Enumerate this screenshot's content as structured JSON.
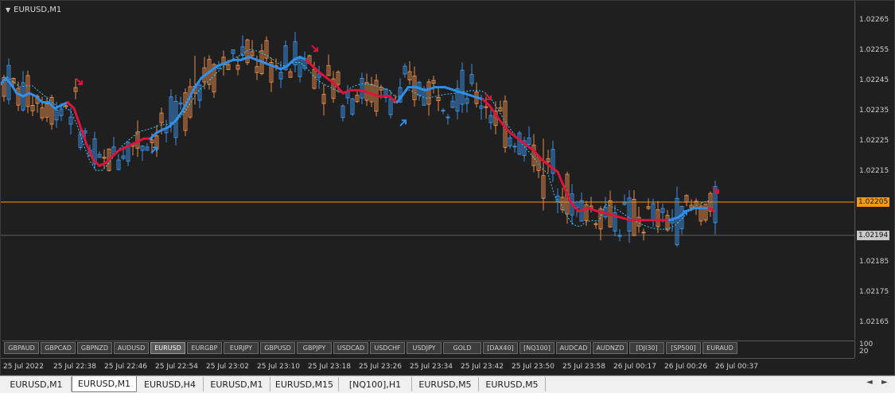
{
  "window": {
    "title": "EURUSD,M1"
  },
  "chart_data": {
    "type": "candlestick",
    "symbol": "EURUSD",
    "timeframe": "M1",
    "ylim": [
      1.0216,
      1.0227
    ],
    "price_ticks": [
      "1.02265",
      "1.02255",
      "1.02245",
      "1.02235",
      "1.02225",
      "1.02215",
      "1.02205",
      "1.02195",
      "1.02185",
      "1.02175",
      "1.02165"
    ],
    "bid_price": "1.02205",
    "ask_price": "1.02194",
    "indicator_ticks": [
      "100",
      "20"
    ],
    "time_ticks": [
      "25 Jul 2022",
      "25 Jul 22:38",
      "25 Jul 22:46",
      "25 Jul 22:54",
      "25 Jul 23:02",
      "25 Jul 23:10",
      "25 Jul 23:18",
      "25 Jul 23:26",
      "25 Jul 23:34",
      "25 Jul 23:42",
      "25 Jul 23:50",
      "25 Jul 23:58",
      "26 Jul 00:17",
      "26 Jul 00:26",
      "26 Jul 00:37"
    ],
    "ma_trend": [
      {
        "x": 0,
        "y": 1.02244,
        "c": "blue"
      },
      {
        "x": 6,
        "y": 1.02246,
        "c": "blue"
      },
      {
        "x": 13,
        "y": 1.02244,
        "c": "blue"
      },
      {
        "x": 20,
        "y": 1.02241,
        "c": "blue"
      },
      {
        "x": 28,
        "y": 1.0224,
        "c": "blue"
      },
      {
        "x": 36,
        "y": 1.02241,
        "c": "blue"
      },
      {
        "x": 44,
        "y": 1.0224,
        "c": "blue"
      },
      {
        "x": 52,
        "y": 1.02238,
        "c": "blue"
      },
      {
        "x": 60,
        "y": 1.02238,
        "c": "blue"
      },
      {
        "x": 68,
        "y": 1.02236,
        "c": "blue"
      },
      {
        "x": 76,
        "y": 1.02237,
        "c": "blue"
      },
      {
        "x": 84,
        "y": 1.02238,
        "c": "blue"
      },
      {
        "x": 92,
        "y": 1.02236,
        "c": "red"
      },
      {
        "x": 100,
        "y": 1.0223,
        "c": "red"
      },
      {
        "x": 108,
        "y": 1.02224,
        "c": "red"
      },
      {
        "x": 116,
        "y": 1.02219,
        "c": "red"
      },
      {
        "x": 124,
        "y": 1.02217,
        "c": "red"
      },
      {
        "x": 132,
        "y": 1.02218,
        "c": "red"
      },
      {
        "x": 140,
        "y": 1.0222,
        "c": "red"
      },
      {
        "x": 148,
        "y": 1.02222,
        "c": "red"
      },
      {
        "x": 156,
        "y": 1.02223,
        "c": "red"
      },
      {
        "x": 164,
        "y": 1.02224,
        "c": "red"
      },
      {
        "x": 172,
        "y": 1.02225,
        "c": "red"
      },
      {
        "x": 180,
        "y": 1.02226,
        "c": "red"
      },
      {
        "x": 188,
        "y": 1.02226,
        "c": "red"
      },
      {
        "x": 196,
        "y": 1.02228,
        "c": "blue"
      },
      {
        "x": 204,
        "y": 1.02229,
        "c": "blue"
      },
      {
        "x": 212,
        "y": 1.0223,
        "c": "blue"
      },
      {
        "x": 220,
        "y": 1.02232,
        "c": "blue"
      },
      {
        "x": 228,
        "y": 1.02235,
        "c": "blue"
      },
      {
        "x": 236,
        "y": 1.02239,
        "c": "blue"
      },
      {
        "x": 244,
        "y": 1.02243,
        "c": "blue"
      },
      {
        "x": 252,
        "y": 1.02246,
        "c": "blue"
      },
      {
        "x": 262,
        "y": 1.02248,
        "c": "blue"
      },
      {
        "x": 272,
        "y": 1.0225,
        "c": "blue"
      },
      {
        "x": 282,
        "y": 1.02251,
        "c": "blue"
      },
      {
        "x": 292,
        "y": 1.02252,
        "c": "blue"
      },
      {
        "x": 302,
        "y": 1.02252,
        "c": "blue"
      },
      {
        "x": 312,
        "y": 1.02253,
        "c": "blue"
      },
      {
        "x": 322,
        "y": 1.02252,
        "c": "blue"
      },
      {
        "x": 332,
        "y": 1.02251,
        "c": "blue"
      },
      {
        "x": 342,
        "y": 1.0225,
        "c": "blue"
      },
      {
        "x": 352,
        "y": 1.02249,
        "c": "blue"
      },
      {
        "x": 360,
        "y": 1.0225,
        "c": "blue"
      },
      {
        "x": 368,
        "y": 1.02252,
        "c": "blue"
      },
      {
        "x": 376,
        "y": 1.02253,
        "c": "blue"
      },
      {
        "x": 384,
        "y": 1.02252,
        "c": "blue"
      },
      {
        "x": 392,
        "y": 1.0225,
        "c": "red"
      },
      {
        "x": 400,
        "y": 1.02248,
        "c": "red"
      },
      {
        "x": 410,
        "y": 1.02246,
        "c": "red"
      },
      {
        "x": 420,
        "y": 1.02244,
        "c": "red"
      },
      {
        "x": 430,
        "y": 1.02241,
        "c": "red"
      },
      {
        "x": 440,
        "y": 1.02242,
        "c": "red"
      },
      {
        "x": 452,
        "y": 1.02242,
        "c": "red"
      },
      {
        "x": 464,
        "y": 1.02241,
        "c": "red"
      },
      {
        "x": 476,
        "y": 1.0224,
        "c": "red"
      },
      {
        "x": 488,
        "y": 1.0224,
        "c": "red"
      },
      {
        "x": 498,
        "y": 1.02238,
        "c": "red"
      },
      {
        "x": 504,
        "y": 1.0224,
        "c": "blue"
      },
      {
        "x": 512,
        "y": 1.02243,
        "c": "blue"
      },
      {
        "x": 522,
        "y": 1.02243,
        "c": "blue"
      },
      {
        "x": 534,
        "y": 1.02242,
        "c": "blue"
      },
      {
        "x": 546,
        "y": 1.02243,
        "c": "blue"
      },
      {
        "x": 558,
        "y": 1.02243,
        "c": "blue"
      },
      {
        "x": 570,
        "y": 1.02242,
        "c": "blue"
      },
      {
        "x": 582,
        "y": 1.02241,
        "c": "blue"
      },
      {
        "x": 594,
        "y": 1.0224,
        "c": "blue"
      },
      {
        "x": 606,
        "y": 1.02239,
        "c": "blue"
      },
      {
        "x": 614,
        "y": 1.02237,
        "c": "red"
      },
      {
        "x": 622,
        "y": 1.02234,
        "c": "red"
      },
      {
        "x": 630,
        "y": 1.02231,
        "c": "red"
      },
      {
        "x": 640,
        "y": 1.02228,
        "c": "red"
      },
      {
        "x": 650,
        "y": 1.02226,
        "c": "red"
      },
      {
        "x": 660,
        "y": 1.02224,
        "c": "red"
      },
      {
        "x": 670,
        "y": 1.02222,
        "c": "red"
      },
      {
        "x": 680,
        "y": 1.02219,
        "c": "red"
      },
      {
        "x": 690,
        "y": 1.02217,
        "c": "red"
      },
      {
        "x": 700,
        "y": 1.02215,
        "c": "red"
      },
      {
        "x": 708,
        "y": 1.0221,
        "c": "red"
      },
      {
        "x": 716,
        "y": 1.02205,
        "c": "red"
      },
      {
        "x": 726,
        "y": 1.02202,
        "c": "red"
      },
      {
        "x": 738,
        "y": 1.02203,
        "c": "red"
      },
      {
        "x": 750,
        "y": 1.02202,
        "c": "red"
      },
      {
        "x": 764,
        "y": 1.02201,
        "c": "red"
      },
      {
        "x": 778,
        "y": 1.022,
        "c": "red"
      },
      {
        "x": 792,
        "y": 1.02199,
        "c": "red"
      },
      {
        "x": 808,
        "y": 1.02199,
        "c": "red"
      },
      {
        "x": 824,
        "y": 1.02199,
        "c": "red"
      },
      {
        "x": 840,
        "y": 1.02199,
        "c": "red"
      },
      {
        "x": 852,
        "y": 1.022,
        "c": "blue"
      },
      {
        "x": 862,
        "y": 1.02202,
        "c": "blue"
      },
      {
        "x": 872,
        "y": 1.02203,
        "c": "blue"
      },
      {
        "x": 882,
        "y": 1.02203,
        "c": "blue"
      },
      {
        "x": 890,
        "y": 1.02203,
        "c": "blue"
      },
      {
        "x": 896,
        "y": 1.02202,
        "c": "red"
      }
    ],
    "candles_note": "candle series drawn procedurally from ma_trend with deviations",
    "signal_arrows": [
      {
        "x": 98,
        "y": 1.02245,
        "dir": "down",
        "c": "red"
      },
      {
        "x": 192,
        "y": 1.02222,
        "dir": "up",
        "c": "blue"
      },
      {
        "x": 394,
        "y": 1.02256,
        "dir": "down",
        "c": "red"
      },
      {
        "x": 505,
        "y": 1.02231,
        "dir": "up",
        "c": "blue"
      },
      {
        "x": 612,
        "y": 1.0224,
        "dir": "down",
        "c": "red"
      },
      {
        "x": 858,
        "y": 1.02201,
        "dir": "up",
        "c": "blue"
      },
      {
        "x": 898,
        "y": 1.02209,
        "dir": "down",
        "c": "red"
      }
    ],
    "colors": {
      "up": "#3b8fe0",
      "down": "#e0894a",
      "ma_up": "#2f8fea",
      "ma_down": "#dc143c",
      "bid": "#f09a18",
      "ask": "#5e5e5e",
      "dashed": "#40c8e8"
    }
  },
  "symbol_buttons": [
    "GBPAUD",
    "GBPCAD",
    "GBPNZD",
    "AUDUSD",
    "EURUSD",
    "EURGBP",
    "EURJPY",
    "GBPUSD",
    "GBPJPY",
    "USDCAD",
    "USDCHF",
    "USDJPY",
    "GOLD",
    "[DAX40]",
    "[NQ100]",
    "AUDCAD",
    "AUDNZD",
    "[DJI30]",
    "[SP500]",
    "EURAUD"
  ],
  "active_symbol": "EURUSD",
  "tabs": [
    "EURUSD,M1",
    "EURUSD,M1",
    "EURUSD,H4",
    "EURUSD,M1",
    "EURUSD,M15",
    "[NQ100],H1",
    "EURUSD,M5",
    "EURUSD,M5"
  ],
  "tab_nav": {
    "prev": "◄",
    "next": "►"
  }
}
